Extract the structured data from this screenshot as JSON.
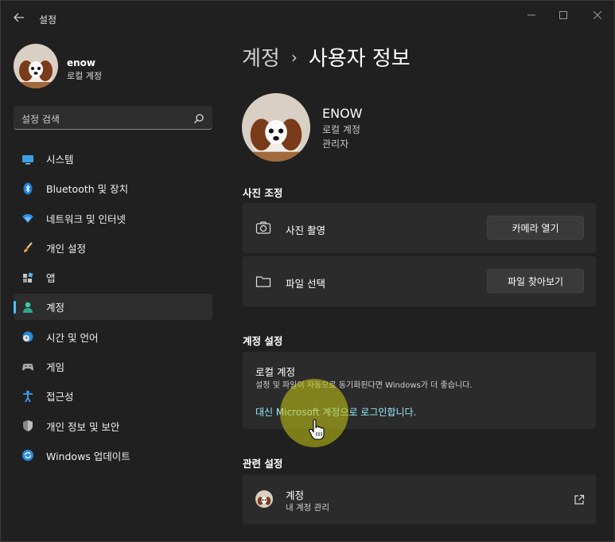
{
  "window": {
    "title": "설정",
    "back_icon": "back-arrow-icon",
    "controls": [
      "minimize-icon",
      "maximize-icon",
      "close-icon"
    ]
  },
  "sidebar": {
    "profile": {
      "name": "enow",
      "account_type": "로컬 계정"
    },
    "search": {
      "placeholder": "설정 검색",
      "icon": "search-icon"
    },
    "items": [
      {
        "label": "시스템",
        "icon": "system-icon",
        "active": false
      },
      {
        "label": "Bluetooth 및 장치",
        "icon": "bluetooth-icon",
        "active": false
      },
      {
        "label": "네트워크 및 인터넷",
        "icon": "wifi-icon",
        "active": false
      },
      {
        "label": "개인 설정",
        "icon": "brush-icon",
        "active": false
      },
      {
        "label": "앱",
        "icon": "apps-icon",
        "active": false
      },
      {
        "label": "계정",
        "icon": "account-icon",
        "active": true
      },
      {
        "label": "시간 및 언어",
        "icon": "globe-clock-icon",
        "active": false
      },
      {
        "label": "게임",
        "icon": "gamepad-icon",
        "active": false
      },
      {
        "label": "접근성",
        "icon": "accessibility-icon",
        "active": false
      },
      {
        "label": "개인 정보 및 보안",
        "icon": "shield-icon",
        "active": false
      },
      {
        "label": "Windows 업데이트",
        "icon": "update-icon",
        "active": false
      }
    ]
  },
  "main": {
    "breadcrumb": {
      "parent": "계정",
      "separator": "›",
      "current": "사용자 정보"
    },
    "user": {
      "name": "ENOW",
      "account_type": "로컬 계정",
      "role": "관리자"
    },
    "photo_section": {
      "title": "사진 조정",
      "take_photo": {
        "label": "사진 촬영",
        "button": "카메라 열기",
        "icon": "camera-icon"
      },
      "choose_file": {
        "label": "파일 선택",
        "button": "파일 찾아보기",
        "icon": "folder-icon"
      }
    },
    "account_settings": {
      "title": "계정 설정",
      "local_title": "로컬 계정",
      "local_desc": "설정 및 파일이 자동으로 동기화된다면 Windows가 더 좋습니다.",
      "signin_link": "대신 Microsoft 계정으로 로그인합니다."
    },
    "related": {
      "title": "관련 설정",
      "item_title": "계정",
      "item_sub": "내 계정 관리",
      "icon": "external-link-icon"
    }
  },
  "colors": {
    "background": "#202020",
    "card": "#2b2b2b",
    "accent": "#4cc2ff",
    "link": "#99ebff",
    "highlight": "#c8c814"
  }
}
